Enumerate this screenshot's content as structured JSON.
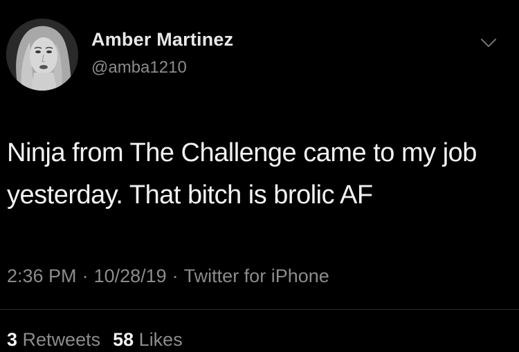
{
  "user": {
    "display_name": "Amber Martinez",
    "handle": "@amba1210",
    "avatar_icon": "profile-photo"
  },
  "tweet": {
    "text": "Ninja from The Challenge came to my job yesterday. That bitch is brolic AF",
    "time": "2:36 PM",
    "date": "10/28/19",
    "source": "Twitter for iPhone",
    "separator": "·"
  },
  "stats": {
    "retweets_count": "3",
    "retweets_label": "Retweets",
    "likes_count": "58",
    "likes_label": "Likes"
  },
  "icons": {
    "menu": "chevron-down-icon"
  },
  "colors": {
    "background": "#000000",
    "primary_text": "#f2f2f2",
    "secondary_text": "#8c8c8c",
    "divider": "#2c2c2c"
  }
}
